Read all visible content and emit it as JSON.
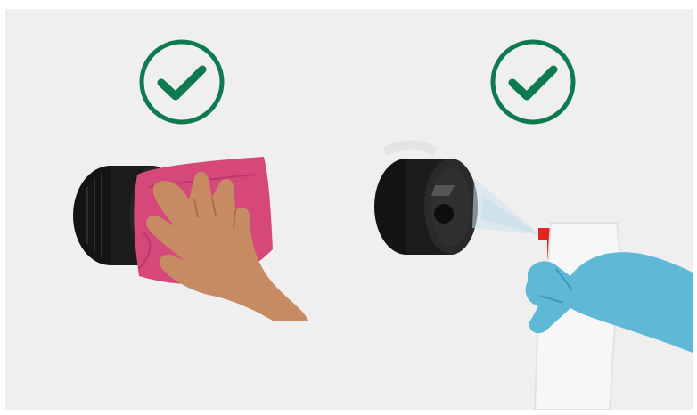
{
  "colors": {
    "background": "#efefef",
    "check_green": "#0e7a4f",
    "device_black": "#1a1a1a",
    "cloth_pink": "#d6487a",
    "glove_blue": "#5fb8d6",
    "trigger_red": "#e0261e"
  },
  "panels": [
    {
      "icon": "checkmark-circle-icon",
      "scene": "wipe-with-cloth"
    },
    {
      "icon": "checkmark-circle-icon",
      "scene": "spray-with-cleaner"
    }
  ]
}
